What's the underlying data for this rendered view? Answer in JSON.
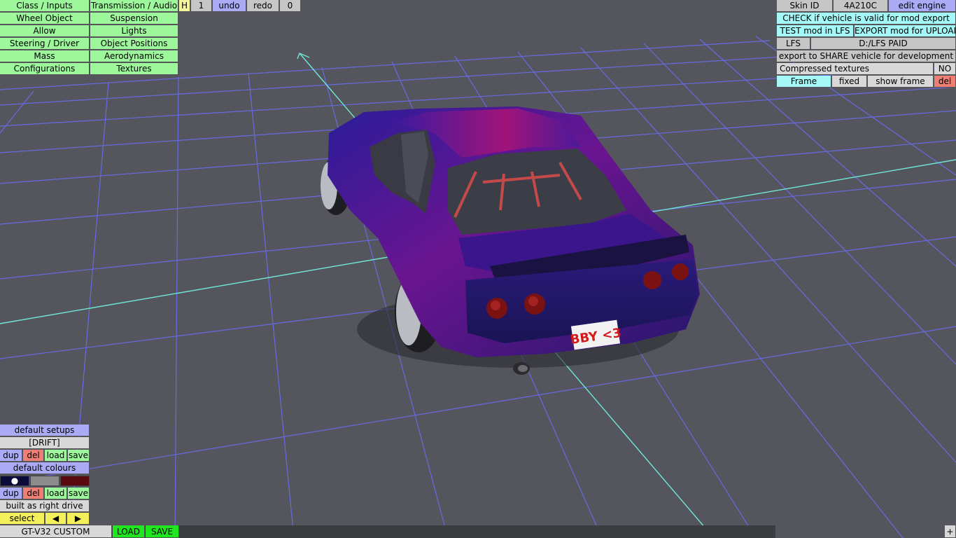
{
  "menu": {
    "col1": [
      "Class / Inputs",
      "Wheel Object",
      "Allow",
      "Steering / Driver",
      "Mass",
      "Configurations"
    ],
    "col2": [
      "Transmission / Audio",
      "Suspension",
      "Lights",
      "Object Positions",
      "Aerodynamics",
      "Textures"
    ]
  },
  "toolbar": {
    "h_label": "H",
    "counter": "1",
    "undo": "undo",
    "redo": "redo",
    "zero": "0"
  },
  "right_panel": {
    "skin_id_label": "Skin ID",
    "skin_id_value": "4A210C",
    "edit_engine": "edit engine",
    "check_valid": "CHECK if vehicle is valid for mod export",
    "test_mod": "TEST mod in LFS",
    "export_mod": "EXPORT mod for UPLOAD",
    "lfs": "LFS",
    "lfs_path": "D:/LFS PAID",
    "export_share": "export to SHARE vehicle for development",
    "compressed_label": "Compressed textures",
    "compressed_value": "NO",
    "frame": "Frame",
    "fixed": "fixed",
    "show_frame": "show frame",
    "del": "del"
  },
  "left_panel": {
    "default_setups": "default setups",
    "setup_name": "[DRIFT]",
    "dup": "dup",
    "del": "del",
    "load": "load",
    "save": "save",
    "default_colours": "default colours",
    "colour_dot": "●",
    "built_as": "built as right drive",
    "select": "select",
    "prev": "◀",
    "next": "▶"
  },
  "bottom": {
    "car_name": "GT-V32 CUSTOM",
    "load": "LOAD",
    "save": "SAVE",
    "plus": "+"
  },
  "plate": {
    "text": "BBY <3"
  },
  "colors": {
    "swatch1": "#0c0c3a",
    "swatch2": "#8c8c8c",
    "swatch3": "#5a0a0e"
  }
}
